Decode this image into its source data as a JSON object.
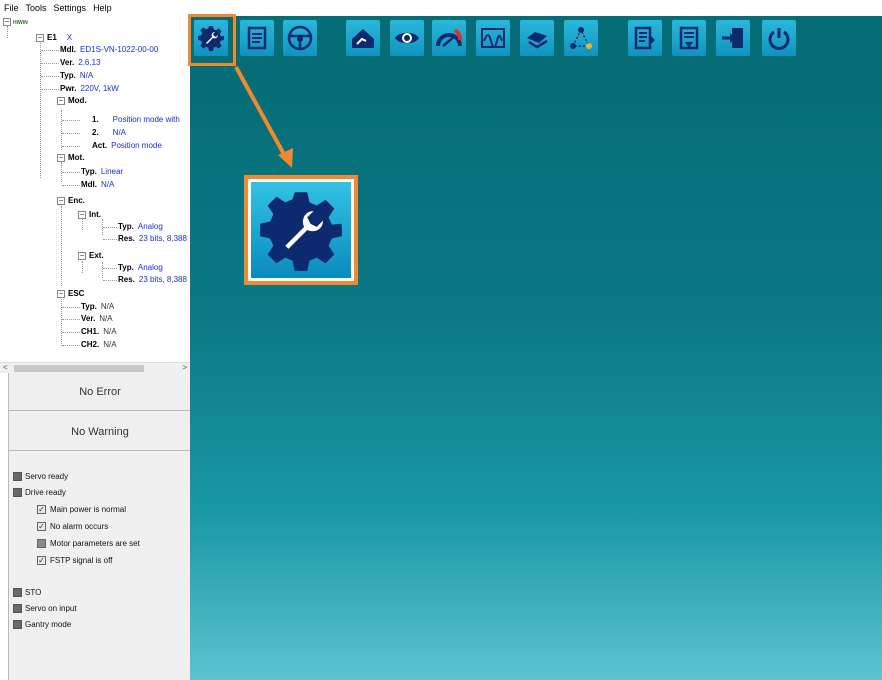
{
  "menu": [
    "File",
    "Tools",
    "Settings",
    "Help"
  ],
  "tree": {
    "root": "HIWIN",
    "axis_key": "E1",
    "axis_value": "X",
    "mdl_key": "Mdl.",
    "mdl": "ED1S-VN-1022-00-00",
    "ver_key": "Ver.",
    "ver": "2.6.13",
    "typ_key": "Typ.",
    "typ": "N/A",
    "pwr_key": "Pwr.",
    "pwr": "220V, 1kW",
    "mod_key": "Mod.",
    "mod1_key": "1.",
    "mod1": "Position mode with",
    "mod2_key": "2.",
    "mod2": "N/A",
    "act_key": "Act.",
    "act": "Position mode",
    "mot_key": "Mot.",
    "mot_typ_key": "Typ.",
    "mot_typ": "Linear",
    "mot_mdl_key": "Mdl.",
    "mot_mdl": "N/A",
    "enc_key": "Enc.",
    "int_key": "Int.",
    "int_typ_key": "Typ.",
    "int_typ": "Analog",
    "int_res_key": "Res.",
    "int_res": "23 bits, 8,388",
    "ext_key": "Ext.",
    "ext_typ_key": "Typ.",
    "ext_typ": "Analog",
    "ext_res_key": "Res.",
    "ext_res": "23 bits, 8,388",
    "esc_key": "ESC",
    "esc_typ_key": "Typ.",
    "esc_typ": "N/A",
    "esc_ver_key": "Ver.",
    "esc_ver": "N/A",
    "esc_ch1_key": "CH1.",
    "esc_ch1": "N/A",
    "esc_ch2_key": "CH2.",
    "esc_ch2": "N/A"
  },
  "status": {
    "error": "No Error",
    "warning": "No Warning",
    "servo_ready": "Servo ready",
    "drive_ready": "Drive ready",
    "main_power": "Main power is normal",
    "no_alarm": "No alarm occurs",
    "motor_params": "Motor parameters are set",
    "fstp": "FSTP signal is off",
    "sto": "STO",
    "servo_on": "Servo on input",
    "gantry": "Gantry mode"
  },
  "toolbar": {
    "icons": [
      "configuration-wizard-icon",
      "parameters-icon",
      "steering-icon",
      "home-icon",
      "monitor-eye-icon",
      "gauge-icon",
      "scope-icon",
      "motor-icon",
      "path-icon",
      "upload-icon",
      "download-icon",
      "import-icon",
      "power-icon"
    ]
  },
  "colors": {
    "accent": "#f08a30",
    "toolbar_bg": "#066c76",
    "icon_bg": "#1aa6d0",
    "value_text": "#1a2fd6"
  }
}
